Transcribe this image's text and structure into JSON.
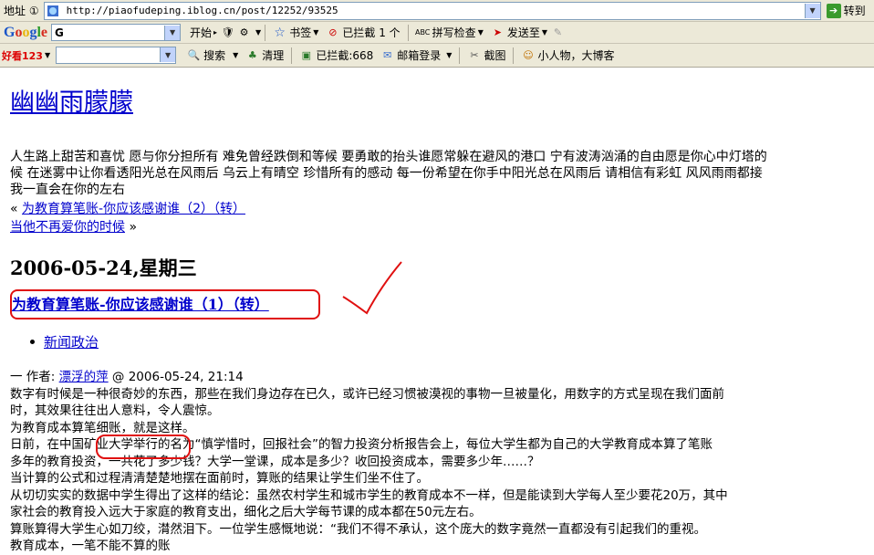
{
  "browser": {
    "address_label": "地址 ①",
    "url": "http://piaofudeping.iblog.cn/post/12252/93525",
    "go_label": "转到",
    "google_toolbar": {
      "logo": "Google",
      "search_prefix": "G",
      "start": "开始",
      "bookmarks": "书签",
      "blocked": "已拦截",
      "blocked_count": "1 个",
      "spellcheck": "拼写检查",
      "send_to": "发送至"
    },
    "second_toolbar": {
      "logo": "好看123",
      "search": "搜索",
      "clear": "清理",
      "blocked": "已拦截:668",
      "mail_login": "邮箱登录",
      "screenshot": "截图",
      "blog_slogan": "小人物，大博客"
    }
  },
  "blog": {
    "title": "幽幽雨朦朦",
    "description_lines": [
      "人生路上甜苦和喜忧  愿与你分担所有  难免曾经跌倒和等候  要勇敢的抬头谁愿常躲在避风的港口  宁有波涛汹涌的自由愿是你心中灯塔的",
      "候  在迷雾中让你看透阳光总在风雨后  乌云上有晴空  珍惜所有的感动  每一份希望在你手中阳光总在风雨后  请相信有彩虹  风风雨雨都接",
      "我一直会在你的左右"
    ],
    "prev_link": "为教育算笔账-你应该感谢谁（2）（转）",
    "next_link": "当他不再爱你的时候",
    "prev_prefix": "«",
    "next_suffix": "»"
  },
  "post": {
    "date": "2006-05-24,星期三",
    "title": "为教育算笔账-你应该感谢谁（1）（转）",
    "category": "新闻政治",
    "author_prefix": "一 作者: ",
    "author": "漂浮的萍",
    "timestamp": " @ 2006-05-24, 21:14",
    "body": [
      "    数字有时候是一种很奇妙的东西，那些在我们身边存在已久，或许已经习惯被漠视的事物一旦被量化，用数字的方式呈现在我们面前",
      "时，其效果往往出人意料，令人震惊。",
      "    为教育成本算笔细账，就是这样。",
      "    日前，在中国矿业大学举行的名为“慎学惜时，回报社会”的智力投资分析报告会上，每位大学生都为自己的大学教育成本算了笔账",
      "多年的教育投资，一共花了多少钱？大学一堂课，成本是多少？收回投资成本，需要多少年……？",
      "    当计算的公式和过程清清楚楚地摆在面前时，算账的结果让学生们坐不住了。",
      "    从切切实实的数据中学生得出了这样的结论：虽然农村学生和城市学生的教育成本不一样，但是能读到大学每人至少要花20万，其中",
      "家社会的教育投入远大于家庭的教育支出，细化之后大学每节课的成本都在50元左右。",
      "    算账算得大学生心如刀绞，潸然泪下。一位学生感慨地说：“我们不得不承认，这个庞大的数字竟然一直都没有引起我们的重视。",
      "教育成本，一笔不能不算的账"
    ]
  }
}
